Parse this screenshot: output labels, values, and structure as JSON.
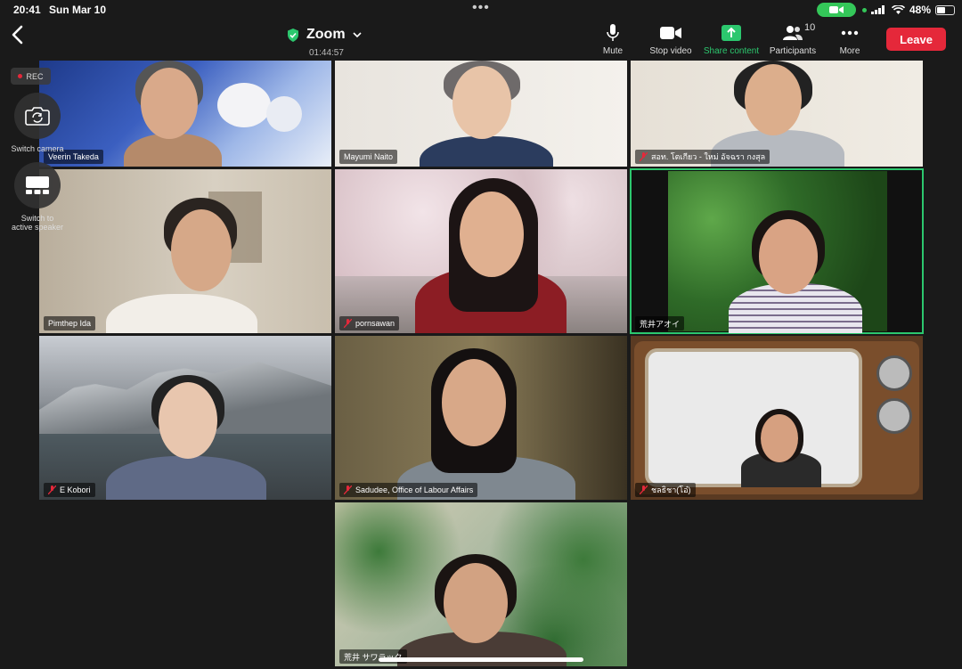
{
  "status_bar": {
    "time": "20:41",
    "date": "Sun Mar 10",
    "battery": "48%"
  },
  "header": {
    "title": "Zoom",
    "duration": "01:44:57"
  },
  "toolbar": {
    "mute": "Mute",
    "stop_video": "Stop video",
    "share_content": "Share content",
    "participants": "Participants",
    "participants_count": "10",
    "more": "More",
    "leave": "Leave"
  },
  "left_controls": {
    "rec": "REC",
    "switch_camera": "Switch camera",
    "switch_speaker_line1": "Switch to",
    "switch_speaker_line2": "active speaker"
  },
  "participants": [
    {
      "name": "Veerin Takeda",
      "muted": false
    },
    {
      "name": "Mayumi Naito",
      "muted": false
    },
    {
      "name": "สอท. โตเกียว - ใหม่ อัจฉรา กงสุล",
      "muted": true
    },
    {
      "name": "Pimthep Ida",
      "muted": false
    },
    {
      "name": "pornsawan",
      "muted": true
    },
    {
      "name": "荒井アオイ",
      "muted": false,
      "active": true
    },
    {
      "name": "E Kobori",
      "muted": true
    },
    {
      "name": "Sadudee, Office of Labour Affairs",
      "muted": true
    },
    {
      "name": "ชลธิชา(โอ๋)",
      "muted": true
    },
    {
      "name": "荒井 サワラック",
      "muted": false
    }
  ],
  "colors": {
    "accent_green": "#2cc76e",
    "leave_red": "#e5283a",
    "background": "#1a1a1a"
  }
}
